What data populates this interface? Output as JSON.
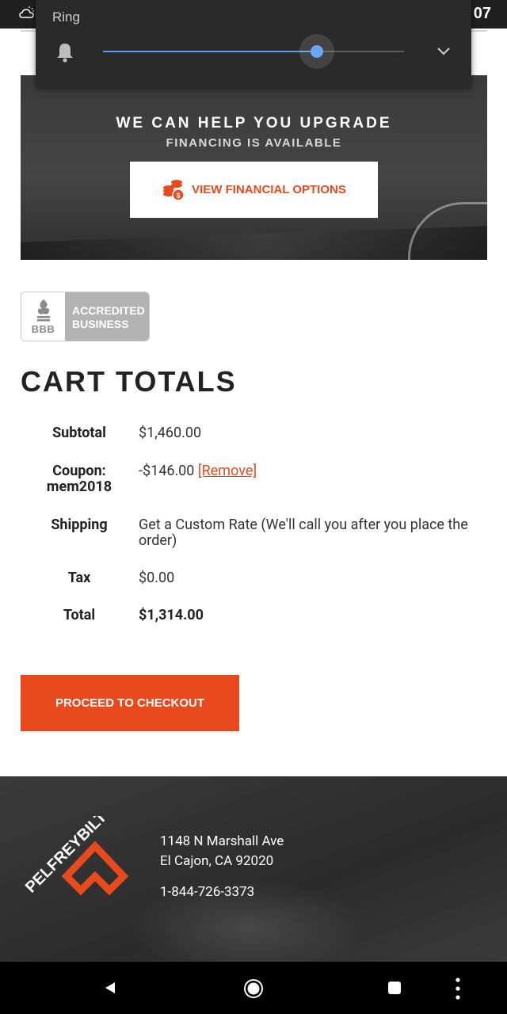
{
  "status_bar": {
    "clock": "07",
    "weather_icon": "cloud-sun-icon"
  },
  "volume_popup": {
    "label": "Ring",
    "level_fraction": 0.71,
    "colors": {
      "fill": "#5b9bf2",
      "thumb": "#6aa6f8"
    }
  },
  "banner": {
    "headline": "WE CAN HELP YOU UPGRADE",
    "subline": "FINANCING IS AVAILABLE",
    "button_label": "VIEW FINANCIAL OPTIONS"
  },
  "bbb": {
    "abbr": "BBB",
    "line1": "ACCREDITED",
    "line2": "BUSINESS"
  },
  "cart": {
    "title": "CART TOTALS",
    "rows": [
      {
        "label": "Subtotal",
        "value": "$1,460.00"
      },
      {
        "label": "Coupon: mem2018",
        "value": "-$146.00",
        "link": "[Remove]"
      },
      {
        "label": "Shipping",
        "value": "Get a Custom Rate (We'll call you after you place the order)"
      },
      {
        "label": "Tax",
        "value": "$0.00"
      },
      {
        "label": "Total",
        "value": "$1,314.00"
      }
    ],
    "checkout_label": "PROCEED TO CHECKOUT"
  },
  "footer": {
    "brand": "PELFREYBILT",
    "address_line1": "1148 N Marshall Ave",
    "address_line2": "El Cajon, CA 92020",
    "phone": "1-844-726-3373"
  },
  "theme": {
    "accent": "#e8491d"
  }
}
